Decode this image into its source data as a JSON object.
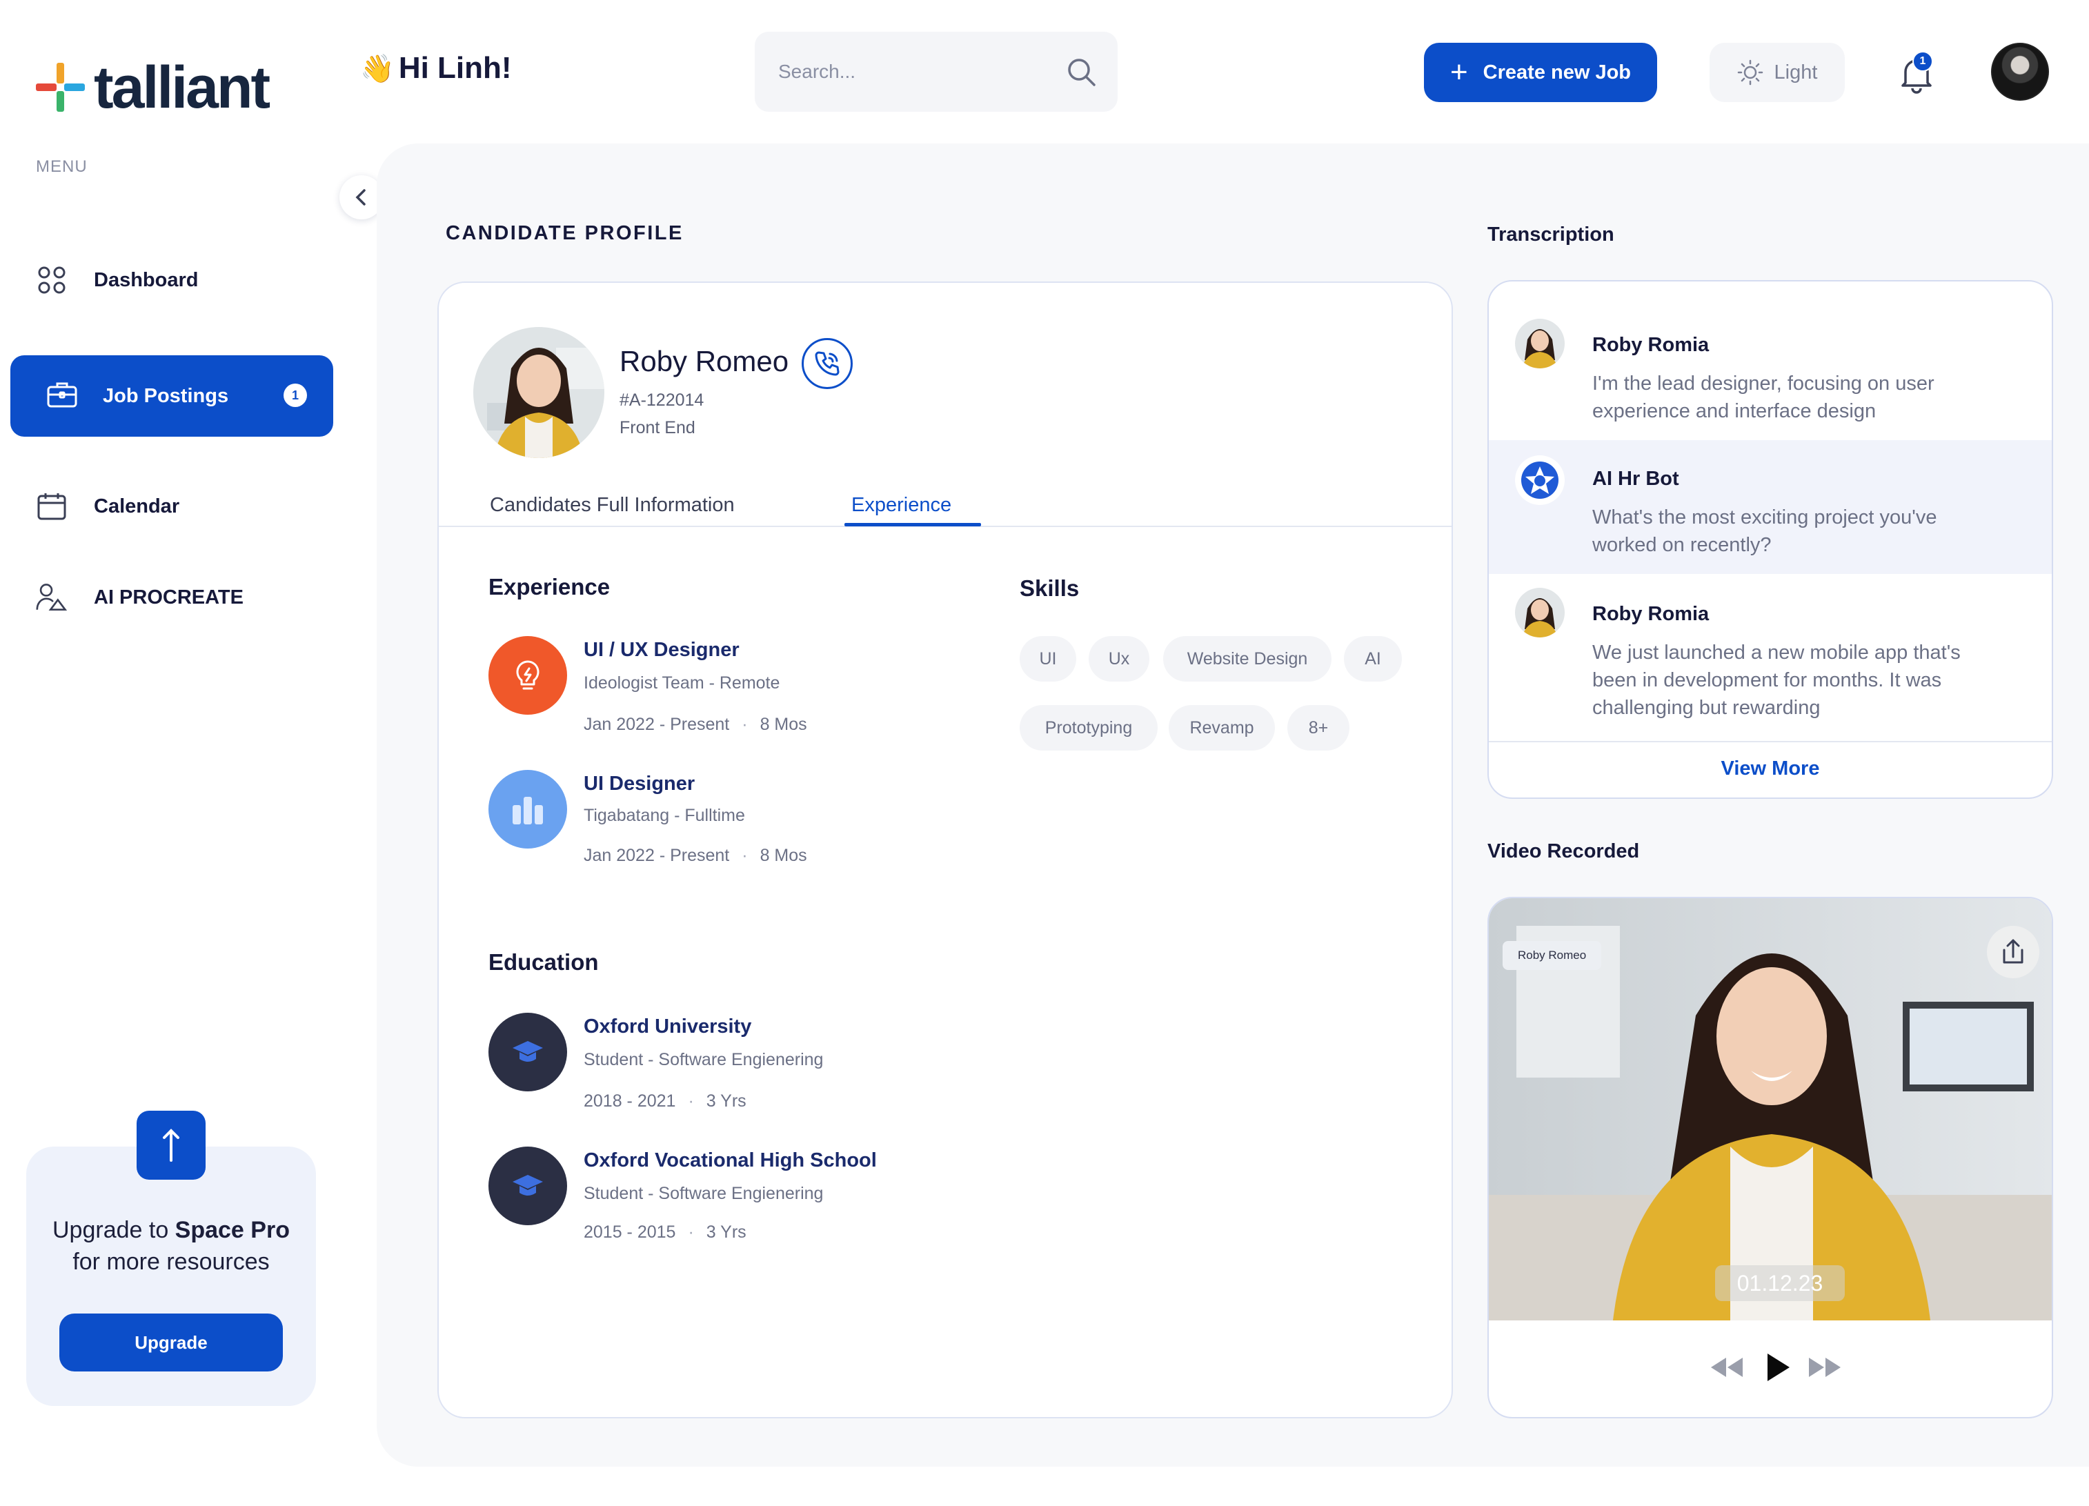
{
  "brand": {
    "name": "talliant"
  },
  "sidebar": {
    "menu_label": "MENU",
    "items": [
      {
        "label": "Dashboard",
        "icon": "dashboard-icon"
      },
      {
        "label": "Job Postings",
        "icon": "briefcase-icon",
        "badge": "1",
        "active": true
      },
      {
        "label": "Calendar",
        "icon": "calendar-icon"
      },
      {
        "label": "AI PROCREATE",
        "icon": "users-icon"
      }
    ],
    "upgrade": {
      "line1_prefix": "Upgrade to ",
      "line1_bold": "Space Pro",
      "line2": "for more resources",
      "button": "Upgrade"
    }
  },
  "header": {
    "greeting": "Hi Linh!",
    "greeting_emoji": "👋",
    "search_placeholder": "Search...",
    "create_button": "Create new Job",
    "theme_label": "Light",
    "notifications_count": "1"
  },
  "profile": {
    "section_title": "CANDIDATE PROFILE",
    "name": "Roby Romeo",
    "id": "#A-122014",
    "role": "Front End",
    "tabs": [
      "Candidates Full Information",
      "Experience"
    ],
    "active_tab": "Experience",
    "experience_title": "Experience",
    "experience": [
      {
        "title": "UI / UX Designer",
        "company": "Ideologist Team - Remote",
        "dates": "Jan 2022 - Present",
        "duration": "8 Mos"
      },
      {
        "title": "UI Designer",
        "company": "Tigabatang - Fulltime",
        "dates": "Jan 2022 - Present",
        "duration": "8 Mos"
      }
    ],
    "education_title": "Education",
    "education": [
      {
        "title": "Oxford University",
        "detail": "Student - Software Engienering",
        "dates": "2018 - 2021",
        "duration": "3 Yrs"
      },
      {
        "title": "Oxford Vocational High School",
        "detail": "Student - Software Engienering",
        "dates": "2015 - 2015",
        "duration": "3 Yrs"
      }
    ],
    "skills_title": "Skills",
    "skills": [
      "UI",
      "Ux",
      "Website Design",
      "AI",
      "Prototyping",
      "Revamp",
      "8+"
    ]
  },
  "transcription": {
    "title": "Transcription",
    "messages": [
      {
        "speaker": "Roby Romia",
        "text_lines": [
          "I'm the lead designer, focusing on user",
          "experience and interface design"
        ]
      },
      {
        "speaker": "AI Hr Bot",
        "text_lines": [
          "What's the most exciting project you've",
          "worked on recently?"
        ]
      },
      {
        "speaker": "Roby Romia",
        "text_lines": [
          "We just launched a new mobile app that's",
          "been in development for months. It was",
          "challenging but rewarding"
        ]
      }
    ],
    "view_more": "View More"
  },
  "video": {
    "title": "Video Recorded",
    "label": "Roby Romeo",
    "timestamp": "01.12.23"
  },
  "colors": {
    "primary": "#0c4ec9",
    "text_dark": "#16193a",
    "muted": "#6b7085",
    "orange": "#f0582a",
    "light_blue": "#6aa2f0",
    "navy_icon": "#2b2f44"
  }
}
